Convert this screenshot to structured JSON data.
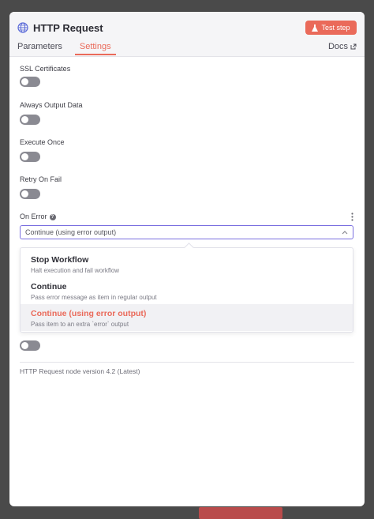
{
  "node": {
    "title": "HTTP Request",
    "test_button": "Test step",
    "docs_label": "Docs"
  },
  "tabs": [
    {
      "label": "Parameters",
      "active": false
    },
    {
      "label": "Settings",
      "active": true
    }
  ],
  "settings": {
    "ssl_certificates": {
      "label": "SSL Certificates",
      "enabled": false
    },
    "always_output_data": {
      "label": "Always Output Data",
      "enabled": false
    },
    "execute_once": {
      "label": "Execute Once",
      "enabled": false
    },
    "retry_on_fail": {
      "label": "Retry On Fail",
      "enabled": false
    },
    "on_error": {
      "label": "On Error",
      "selected": "Continue (using error output)",
      "options": [
        {
          "name": "Stop Workflow",
          "description": "Halt execution and fail workflow"
        },
        {
          "name": "Continue",
          "description": "Pass error message as item in regular output"
        },
        {
          "name": "Continue (using error output)",
          "description": "Pass item to an extra `error` output"
        }
      ]
    }
  },
  "version_note": "HTTP Request node version 4.2 (Latest)",
  "colors": {
    "accent": "#ea6a5a",
    "focus_border": "#7a6fe0",
    "toggle_off": "#8a8a92"
  }
}
